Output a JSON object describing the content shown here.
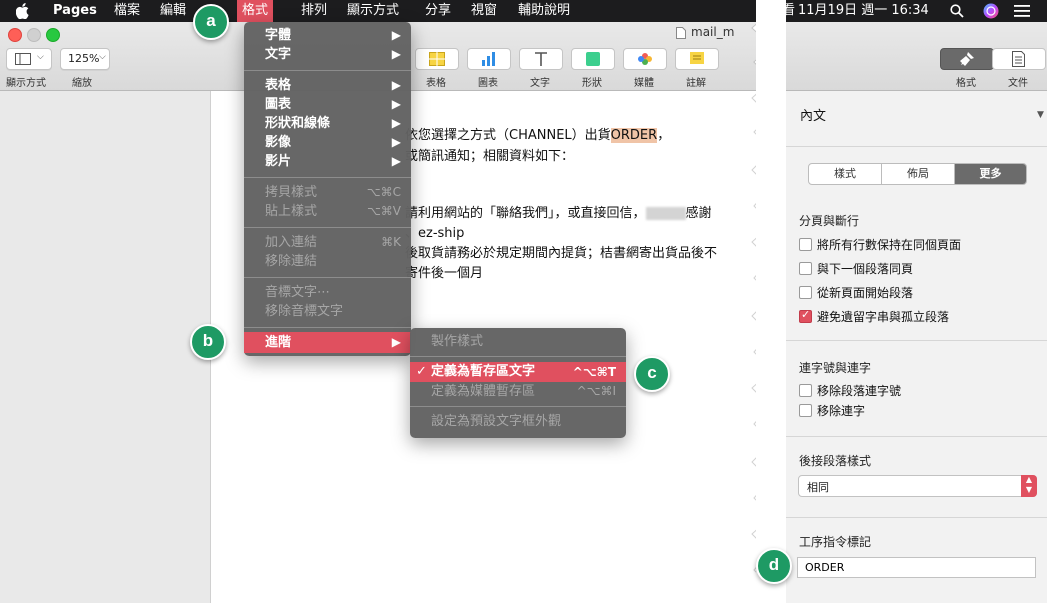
{
  "menubar": {
    "apple_icon": "apple-logo-icon",
    "items": [
      "Pages",
      "檔案",
      "編輯",
      "格式",
      "排列",
      "顯示方式",
      "分享",
      "視窗",
      "輔助說明"
    ],
    "active": "格式",
    "clock": "11月19日 週一 16:34",
    "right_partial": "看",
    "accent": "#e0505f"
  },
  "toolbar": {
    "view_label": "顯示方式",
    "zoom_value": "125%",
    "zoom_label": "縮放",
    "doc_title": "mail_m",
    "insert": [
      {
        "label": "表格",
        "icon": "table-icon"
      },
      {
        "label": "圖表",
        "icon": "chart-icon"
      },
      {
        "label": "文字",
        "icon": "text-icon"
      },
      {
        "label": "形狀",
        "icon": "shape-icon"
      },
      {
        "label": "媒體",
        "icon": "media-icon"
      },
      {
        "label": "註解",
        "icon": "comment-icon"
      }
    ],
    "format_label": "格式",
    "document_label": "文件"
  },
  "format_menu": {
    "items": [
      {
        "label": "字體",
        "submenu": true
      },
      {
        "label": "文字",
        "submenu": true
      },
      {
        "label": "表格",
        "submenu": true
      },
      {
        "label": "圖表",
        "submenu": true
      },
      {
        "label": "形狀和線條",
        "submenu": true
      },
      {
        "label": "影像",
        "submenu": true
      },
      {
        "label": "影片",
        "submenu": true
      },
      {
        "label": "拷貝樣式",
        "shortcut": "⌥⌘C"
      },
      {
        "label": "貼上樣式",
        "shortcut": "⌥⌘V"
      },
      {
        "label": "加入連結",
        "shortcut": "⌘K"
      },
      {
        "label": "移除連結"
      },
      {
        "label": "音標文字⋯"
      },
      {
        "label": "移除音標文字"
      },
      {
        "label": "進階",
        "submenu": true
      }
    ]
  },
  "advanced_menu": {
    "items": [
      {
        "label": "製作樣式"
      },
      {
        "label": "定義為暫存區文字",
        "shortcut": "^⌥⌘T",
        "checked": true
      },
      {
        "label": "定義為媒體暫存區",
        "shortcut": "^⌥⌘I"
      },
      {
        "label": "設定為預設文字框外觀"
      }
    ]
  },
  "document": {
    "lines": [
      {
        "pre": "依您選擇之方式（CHANNEL）出貨",
        "highlight": "ORDER",
        "post": "，"
      },
      {
        "pre": "或簡訊通知；相關資料如下："
      },
      {
        "pre": "請利用網站的「聯絡我們」，或直接回信，",
        "post": "感謝"
      },
      {
        "pre": "、ez-ship"
      },
      {
        "pre": "後取貨請務必於規定期間內提貨；桔書網寄出貨品後不"
      },
      {
        "pre": "寄件後一個月"
      }
    ]
  },
  "inspector": {
    "title": "內文",
    "tabs": [
      "樣式",
      "佈局",
      "更多"
    ],
    "active_tab": "更多",
    "pagination": {
      "heading": "分頁與斷行",
      "options": [
        {
          "label": "將所有行數保持在同個頁面",
          "checked": false
        },
        {
          "label": "與下一個段落同頁",
          "checked": false
        },
        {
          "label": "從新頁面開始段落",
          "checked": false
        },
        {
          "label": "避免遺留字串與孤立段落",
          "checked": true
        }
      ]
    },
    "hyphenation": {
      "heading": "連字號與連字",
      "options": [
        {
          "label": "移除段落連字號",
          "checked": false
        },
        {
          "label": "移除連字",
          "checked": false
        }
      ]
    },
    "following_style": {
      "heading": "後接段落樣式",
      "value": "相同"
    },
    "script_tag": {
      "heading": "工序指令標記",
      "value": "ORDER"
    }
  },
  "badges": [
    "a",
    "b",
    "c",
    "d"
  ]
}
